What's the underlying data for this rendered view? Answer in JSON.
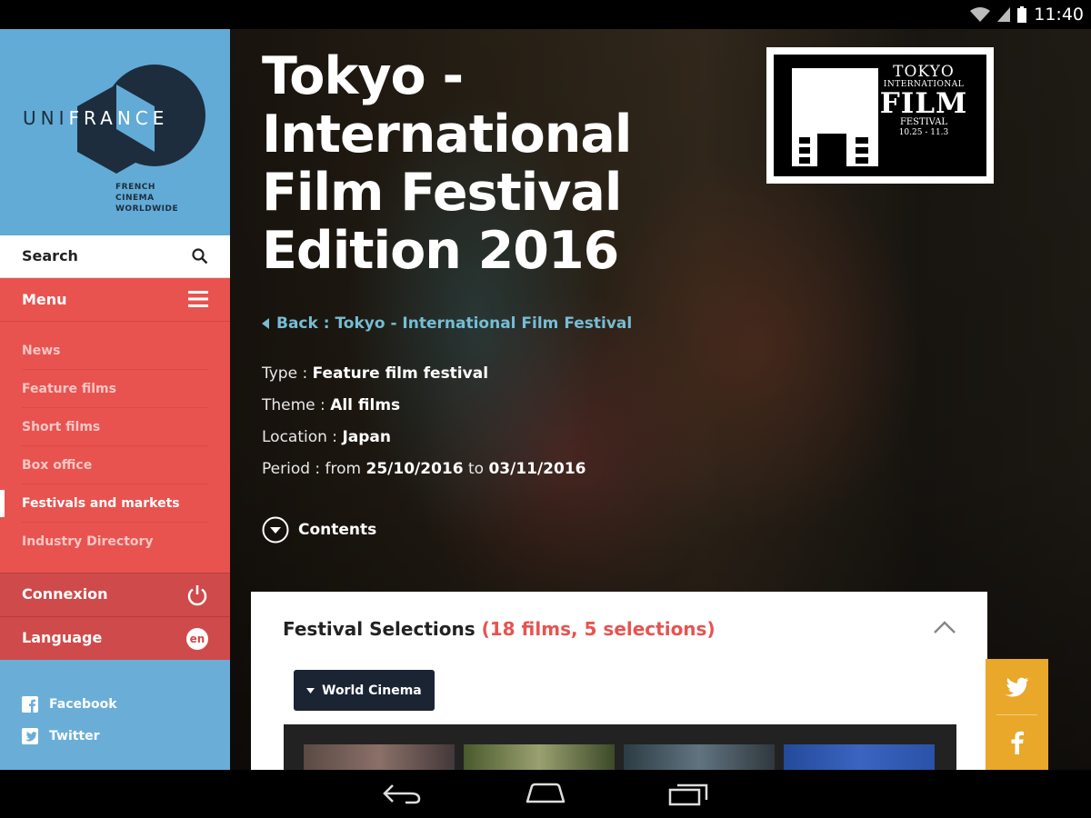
{
  "status_bar": {
    "time": "11:40",
    "icons": [
      "wifi-icon",
      "signal-icon",
      "battery-icon"
    ]
  },
  "brand": {
    "logo_letters": [
      "U",
      "N",
      "I",
      "F",
      "R",
      "A",
      "N",
      "C",
      "E"
    ],
    "tagline": [
      "FRENCH",
      "CINEMA",
      "WORLDWIDE"
    ]
  },
  "sidebar": {
    "search_label": "Search",
    "menu_title": "Menu",
    "items": [
      {
        "label": "News",
        "active": false
      },
      {
        "label": "Feature films",
        "active": false
      },
      {
        "label": "Short films",
        "active": false
      },
      {
        "label": "Box office",
        "active": false
      },
      {
        "label": "Festivals and markets",
        "active": true
      },
      {
        "label": "Industry Directory",
        "active": false
      }
    ],
    "connexion_label": "Connexion",
    "language_label": "Language",
    "language_code": "en",
    "social": [
      {
        "label": "Facebook",
        "icon": "facebook-icon"
      },
      {
        "label": "Twitter",
        "icon": "twitter-icon"
      }
    ]
  },
  "festival": {
    "title": "Tokyo - International Film Festival Edition 2016",
    "back_link": "Back : Tokyo - International Film Festival",
    "type_label": "Type :",
    "type_value": "Feature film festival",
    "theme_label": "Theme :",
    "theme_value": "All films",
    "location_label": "Location :",
    "location_value": "Japan",
    "period_label": "Period : from",
    "period_start": "25/10/2016",
    "period_to": "to",
    "period_end": "03/11/2016",
    "contents_label": "Contents"
  },
  "festival_logo": {
    "line1": "TOKYO",
    "line2": "INTERNATIONAL",
    "line3": "FILM",
    "line4": "FESTIVAL",
    "dates": "10.25 - 11.3"
  },
  "selections": {
    "title": "Festival Selections",
    "count": "(18 films, 5 selections)",
    "filter_label": "World Cinema",
    "thumbnails": 4
  },
  "share": {
    "buttons": [
      "twitter-icon",
      "facebook-icon"
    ]
  },
  "colors": {
    "sidebar_blue": "#6aaed8",
    "menu_red": "#e8534f",
    "connexion_red": "#cf4a4a",
    "link_teal": "#76bdd4",
    "share_yellow": "#e9a82a",
    "filter_navy": "#1b2433"
  }
}
